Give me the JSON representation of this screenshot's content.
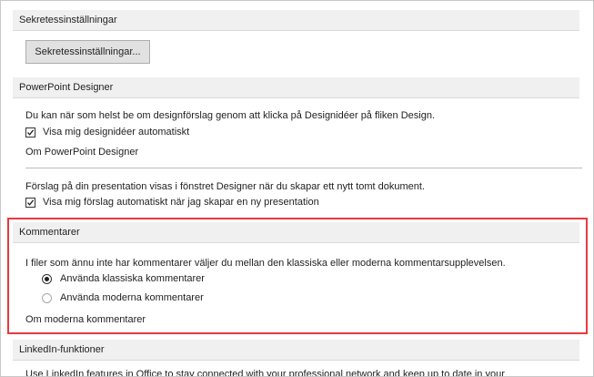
{
  "privacy": {
    "title": "Sekretessinställningar",
    "button_label": "Sekretessinställningar..."
  },
  "designer": {
    "title": "PowerPoint Designer",
    "description": "Du kan när som helst be om designförslag genom att klicka på Designidéer på fliken Design.",
    "auto_show_label": "Visa mig designidéer automatiskt",
    "auto_show_checked": true,
    "about_label": "Om PowerPoint Designer",
    "new_pres_description": "Förslag på din presentation visas i fönstret Designer när du skapar ett nytt tomt dokument.",
    "new_pres_label": "Visa mig förslag automatiskt när jag skapar en ny presentation",
    "new_pres_checked": true
  },
  "comments": {
    "title": "Kommentarer",
    "description": "I filer som ännu inte har kommentarer väljer du mellan den klassiska eller moderna kommentarsupplevelsen.",
    "options": [
      {
        "label": "Använda klassiska kommentarer",
        "selected": true
      },
      {
        "label": "Använda moderna kommentarer",
        "selected": false
      }
    ],
    "about_label": "Om moderna kommentarer",
    "highlight_color": "#e8393f"
  },
  "linkedin": {
    "title": "LinkedIn-funktioner",
    "description": "Use LinkedIn features in Office to stay connected with your professional network and keep up to date in your"
  }
}
